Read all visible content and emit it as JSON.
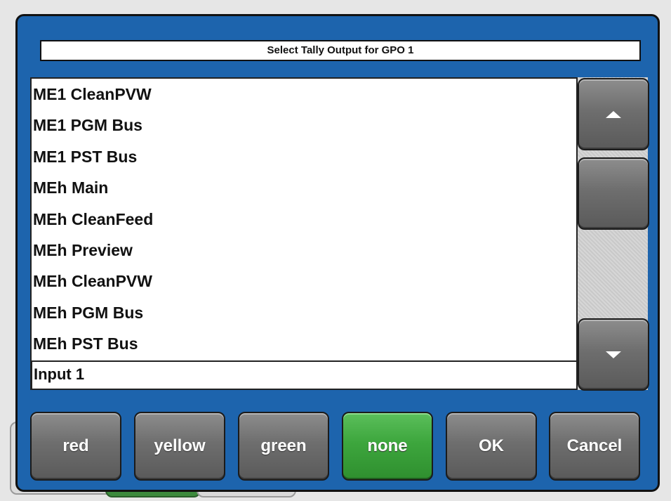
{
  "dialog": {
    "title": "Select Tally Output for GPO 1"
  },
  "list": {
    "items": [
      "ME1 CleanPVW",
      "ME1 PGM Bus",
      "ME1 PST Bus",
      "MEh Main",
      "MEh CleanFeed",
      "MEh Preview",
      "MEh CleanPVW",
      "MEh PGM Bus",
      "MEh PST Bus"
    ],
    "selected_value": "Input 1"
  },
  "scrollbar": {
    "up_icon": "chevron-up-icon",
    "down_icon": "chevron-down-icon"
  },
  "buttons": {
    "red": "red",
    "yellow": "yellow",
    "green": "green",
    "none": "none",
    "ok": "OK",
    "cancel": "Cancel"
  },
  "colors": {
    "dialog_bg": "#1d64ad",
    "active_button": "#3da63d"
  }
}
